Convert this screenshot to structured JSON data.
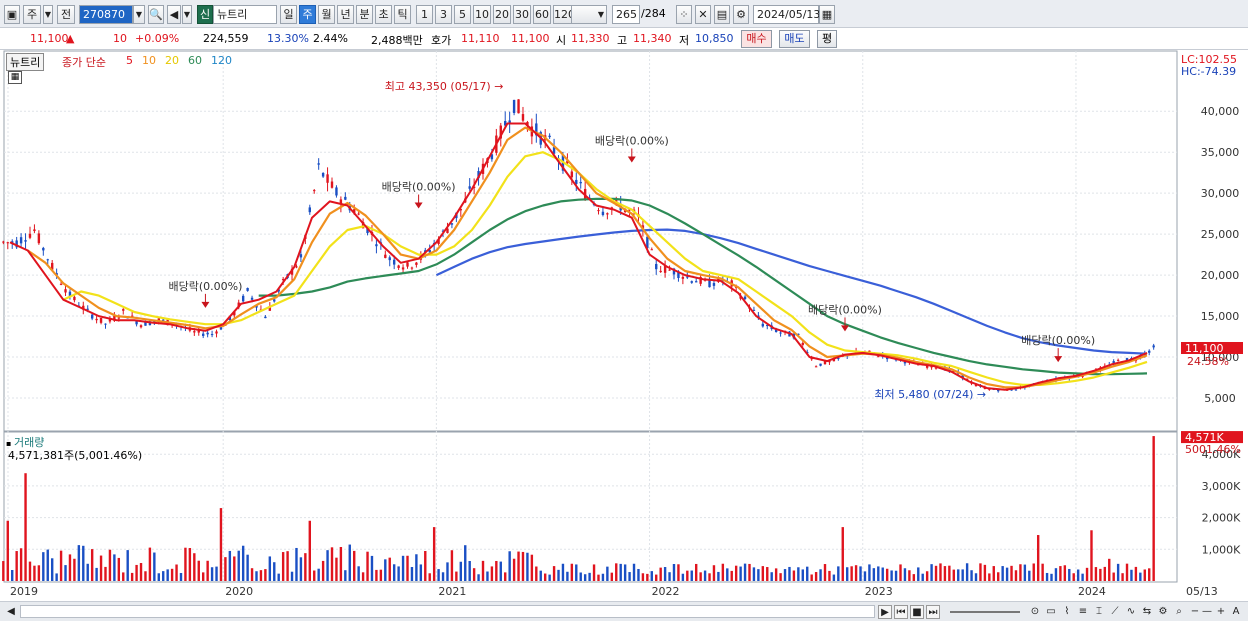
{
  "toolbar": {
    "period_button": "주",
    "prev_label": "전",
    "stock_code": "270870",
    "badge": "신",
    "stock_name": "뉴트리",
    "period_tabs": [
      "일",
      "주",
      "월",
      "년",
      "분",
      "초",
      "틱"
    ],
    "selected_period": "주",
    "interval_tabs": [
      "1",
      "3",
      "5",
      "10",
      "20",
      "30",
      "60",
      "120"
    ],
    "count": "265",
    "total": "/284",
    "date": "2024/05/13"
  },
  "quote": {
    "price": "11,100",
    "arrow": "▲",
    "change": "10",
    "change_pct": "+0.09%",
    "volume": "224,559",
    "turnover_pct": "13.30%",
    "ratio": "2.44%",
    "amount": "2,488백만",
    "bid_label": "호가",
    "bid1": "11,110",
    "bid2": "11,100",
    "open_label": "시",
    "open": "11,330",
    "high_label": "고",
    "high": "11,340",
    "low_label": "저",
    "low": "10,850",
    "buy_button": "매수",
    "sell_button": "매도",
    "eval_button": "평"
  },
  "legend": {
    "stock_tag": "뉴트리",
    "ma_label": "종가 단순",
    "ma_periods": [
      "5",
      "10",
      "20",
      "60",
      "120"
    ],
    "lc": "LC:102.55",
    "hc": "HC:-74.39",
    "volume_title": "거래량",
    "volume_value": "4,571,381주(5,001.46%)"
  },
  "colors": {
    "up": "#e0141e",
    "down": "#1a4fc4",
    "ma5": "#e0141e",
    "ma10": "#f0901e",
    "ma20": "#f2e21a",
    "ma60": "#2e8b57",
    "ma120": "#3a5fd8",
    "price_tag_bg": "#e0141e"
  },
  "chart_data": {
    "type": "candlestick",
    "title": "",
    "period": "weekly",
    "y_ticks": [
      "40,000",
      "35,000",
      "30,000",
      "25,000",
      "20,000",
      "15,000",
      "10,000",
      "5,000"
    ],
    "y_tick_values": [
      40000,
      35000,
      30000,
      25000,
      20000,
      15000,
      10000,
      5000
    ],
    "ylim": [
      2800,
      46500
    ],
    "x_ticks": [
      "2019",
      "2020",
      "2021",
      "2022",
      "2023",
      "2024",
      "05/13"
    ],
    "close_series": [
      [
        "2019-01",
        24000
      ],
      [
        "2019-02",
        25500
      ],
      [
        "2019-03",
        21000
      ],
      [
        "2019-04",
        17500
      ],
      [
        "2019-05",
        15500
      ],
      [
        "2019-06",
        14000
      ],
      [
        "2019-07",
        15500
      ],
      [
        "2019-08",
        14000
      ],
      [
        "2019-09",
        14500
      ],
      [
        "2019-10",
        14000
      ],
      [
        "2019-11",
        13000
      ],
      [
        "2019-12",
        12800
      ],
      [
        "2020-01",
        14500
      ],
      [
        "2020-02",
        18000
      ],
      [
        "2020-03",
        15000
      ],
      [
        "2020-04",
        19000
      ],
      [
        "2020-05",
        22000
      ],
      [
        "2020-06",
        33000
      ],
      [
        "2020-07",
        30000
      ],
      [
        "2020-08",
        28000
      ],
      [
        "2020-09",
        25000
      ],
      [
        "2020-10",
        22000
      ],
      [
        "2020-11",
        21000
      ],
      [
        "2020-12",
        22500
      ],
      [
        "2021-01",
        25000
      ],
      [
        "2021-02",
        28000
      ],
      [
        "2021-03",
        32000
      ],
      [
        "2021-04",
        36000
      ],
      [
        "2021-05",
        41000
      ],
      [
        "2021-06",
        38000
      ],
      [
        "2021-07",
        36000
      ],
      [
        "2021-08",
        33000
      ],
      [
        "2021-09",
        30000
      ],
      [
        "2021-10",
        28000
      ],
      [
        "2021-11",
        28500
      ],
      [
        "2021-12",
        27000
      ],
      [
        "2022-01",
        21000
      ],
      [
        "2022-02",
        20500
      ],
      [
        "2022-03",
        19500
      ],
      [
        "2022-04",
        19000
      ],
      [
        "2022-05",
        19500
      ],
      [
        "2022-06",
        17000
      ],
      [
        "2022-07",
        14000
      ],
      [
        "2022-08",
        13000
      ],
      [
        "2022-09",
        12500
      ],
      [
        "2022-10",
        9000
      ],
      [
        "2022-11",
        9500
      ],
      [
        "2022-12",
        10500
      ],
      [
        "2023-01",
        10500
      ],
      [
        "2023-02",
        10000
      ],
      [
        "2023-03",
        9500
      ],
      [
        "2023-04",
        9000
      ],
      [
        "2023-05",
        8800
      ],
      [
        "2023-06",
        8000
      ],
      [
        "2023-07",
        6500
      ],
      [
        "2023-08",
        6000
      ],
      [
        "2023-09",
        6000
      ],
      [
        "2023-10",
        6500
      ],
      [
        "2023-11",
        7000
      ],
      [
        "2023-12",
        7500
      ],
      [
        "2024-01",
        7800
      ],
      [
        "2024-02",
        8500
      ],
      [
        "2024-03",
        9500
      ],
      [
        "2024-04",
        9800
      ],
      [
        "2024-05",
        11100
      ]
    ],
    "ma": {
      "ma5": [
        24000,
        23000,
        20000,
        17000,
        16000,
        15000,
        14500,
        14500,
        14200,
        14000,
        13500,
        13200,
        14000,
        16500,
        17000,
        18000,
        21000,
        27000,
        29000,
        28500,
        26000,
        23500,
        21500,
        22000,
        24000,
        27000,
        30500,
        34500,
        38500,
        38500,
        36500,
        33500,
        30500,
        28500,
        28000,
        27000,
        22500,
        21000,
        20000,
        19500,
        19300,
        17800,
        15000,
        13500,
        12800,
        10000,
        9500,
        10300,
        10500,
        10200,
        9700,
        9200,
        8900,
        8200,
        7000,
        6200,
        6000,
        6300,
        6900,
        7400,
        7700,
        8300,
        9100,
        9600,
        10500
      ],
      "ma10": [
        null,
        23000,
        21500,
        19000,
        17500,
        16000,
        15000,
        14800,
        14500,
        14200,
        13900,
        13500,
        13800,
        15200,
        16500,
        17300,
        19500,
        24000,
        27500,
        28800,
        27300,
        25000,
        22500,
        22000,
        23000,
        25500,
        29000,
        32500,
        36500,
        38000,
        37000,
        35000,
        32500,
        30000,
        28800,
        27500,
        24500,
        22000,
        20500,
        20000,
        19600,
        18500,
        16500,
        14500,
        13300,
        11300,
        10000,
        10200,
        10400,
        10300,
        9900,
        9400,
        9000,
        8500,
        7500,
        6700,
        6300,
        6300,
        6700,
        7200,
        7600,
        8100,
        8800,
        9400,
        10200
      ],
      "ma20": [
        null,
        null,
        null,
        17000,
        18000,
        17500,
        16500,
        15500,
        15000,
        14600,
        14300,
        14000,
        14000,
        14500,
        15500,
        16500,
        17500,
        20500,
        23500,
        25500,
        26000,
        25000,
        23500,
        22500,
        22500,
        23500,
        25500,
        28500,
        32000,
        34500,
        35000,
        34000,
        32500,
        30500,
        29000,
        28000,
        26000,
        24000,
        22000,
        20500,
        20000,
        19500,
        18000,
        16500,
        15000,
        13000,
        11500,
        10800,
        10600,
        10400,
        10200,
        9800,
        9300,
        8900,
        8200,
        7500,
        6900,
        6600,
        6600,
        6800,
        7100,
        7500,
        8100,
        8700,
        9400
      ],
      "ma60": [
        null,
        null,
        null,
        null,
        null,
        null,
        null,
        null,
        null,
        null,
        null,
        null,
        null,
        null,
        17500,
        17500,
        17700,
        18000,
        18500,
        19200,
        19600,
        19900,
        20200,
        20500,
        21300,
        22500,
        24000,
        25500,
        26800,
        27800,
        28500,
        29000,
        29200,
        29300,
        29300,
        29100,
        28500,
        27500,
        26300,
        25000,
        23700,
        22400,
        21000,
        19500,
        18000,
        16500,
        15000,
        14000,
        13200,
        12400,
        11700,
        11100,
        10500,
        10000,
        9500,
        9100,
        8800,
        8500,
        8300,
        8100,
        8000,
        7900,
        7900,
        7950,
        8000
      ],
      "ma120": [
        null,
        null,
        null,
        null,
        null,
        null,
        null,
        null,
        null,
        null,
        null,
        null,
        null,
        null,
        null,
        null,
        null,
        null,
        null,
        null,
        null,
        null,
        null,
        null,
        20000,
        21000,
        22000,
        22800,
        23400,
        23800,
        24100,
        24400,
        24700,
        24950,
        25200,
        25400,
        25500,
        25550,
        25400,
        25000,
        24500,
        23900,
        23200,
        22500,
        21800,
        21100,
        20500,
        19900,
        19300,
        18700,
        18000,
        17300,
        16500,
        15600,
        14700,
        13800,
        13000,
        12300,
        11800,
        11400,
        11100,
        10800,
        10600,
        10500,
        10400
      ]
    },
    "annotations": [
      {
        "text": "최고 43,350 (05/17)",
        "type": "high",
        "value": 43350
      },
      {
        "text": "최저 5,480 (07/24)",
        "type": "low",
        "value": 5480
      },
      {
        "text": "배당락(0.00%)",
        "type": "ex-dividend",
        "date": "2019-12"
      },
      {
        "text": "배당락(0.00%)",
        "type": "ex-dividend",
        "date": "2020-12"
      },
      {
        "text": "배당락(0.00%)",
        "type": "ex-dividend",
        "date": "2021-12"
      },
      {
        "text": "배당락(0.00%)",
        "type": "ex-dividend",
        "date": "2022-12"
      },
      {
        "text": "배당락(0.00%)",
        "type": "ex-dividend",
        "date": "2023-12"
      }
    ],
    "right_labels": {
      "price_tag": "11,100",
      "price_pct": "24.58%",
      "volume_tag": "4,571K",
      "volume_pct": "5001.46%"
    },
    "volume": {
      "title": "거래량",
      "y_ticks": [
        "4,000K",
        "3,000K",
        "2,000K",
        "1,000K"
      ],
      "y_tick_values": [
        4000000,
        3000000,
        2000000,
        1000000
      ],
      "ylim": [
        0,
        4700000
      ],
      "spikes": [
        [
          "2019-01",
          1900000
        ],
        [
          "2019-02",
          3400000
        ],
        [
          "2020-01",
          2300000
        ],
        [
          "2020-06",
          1900000
        ],
        [
          "2021-01",
          1700000
        ],
        [
          "2022-12",
          1700000
        ],
        [
          "2023-11",
          1450000
        ],
        [
          "2024-02",
          1600000
        ],
        [
          "2024-03",
          700000
        ],
        [
          "2024-05",
          4571381
        ]
      ]
    },
    "grid": true,
    "legend_position": "top-left"
  },
  "scroll": {
    "buttons": [
      "▶",
      "⏮",
      "■",
      "⏭"
    ]
  }
}
